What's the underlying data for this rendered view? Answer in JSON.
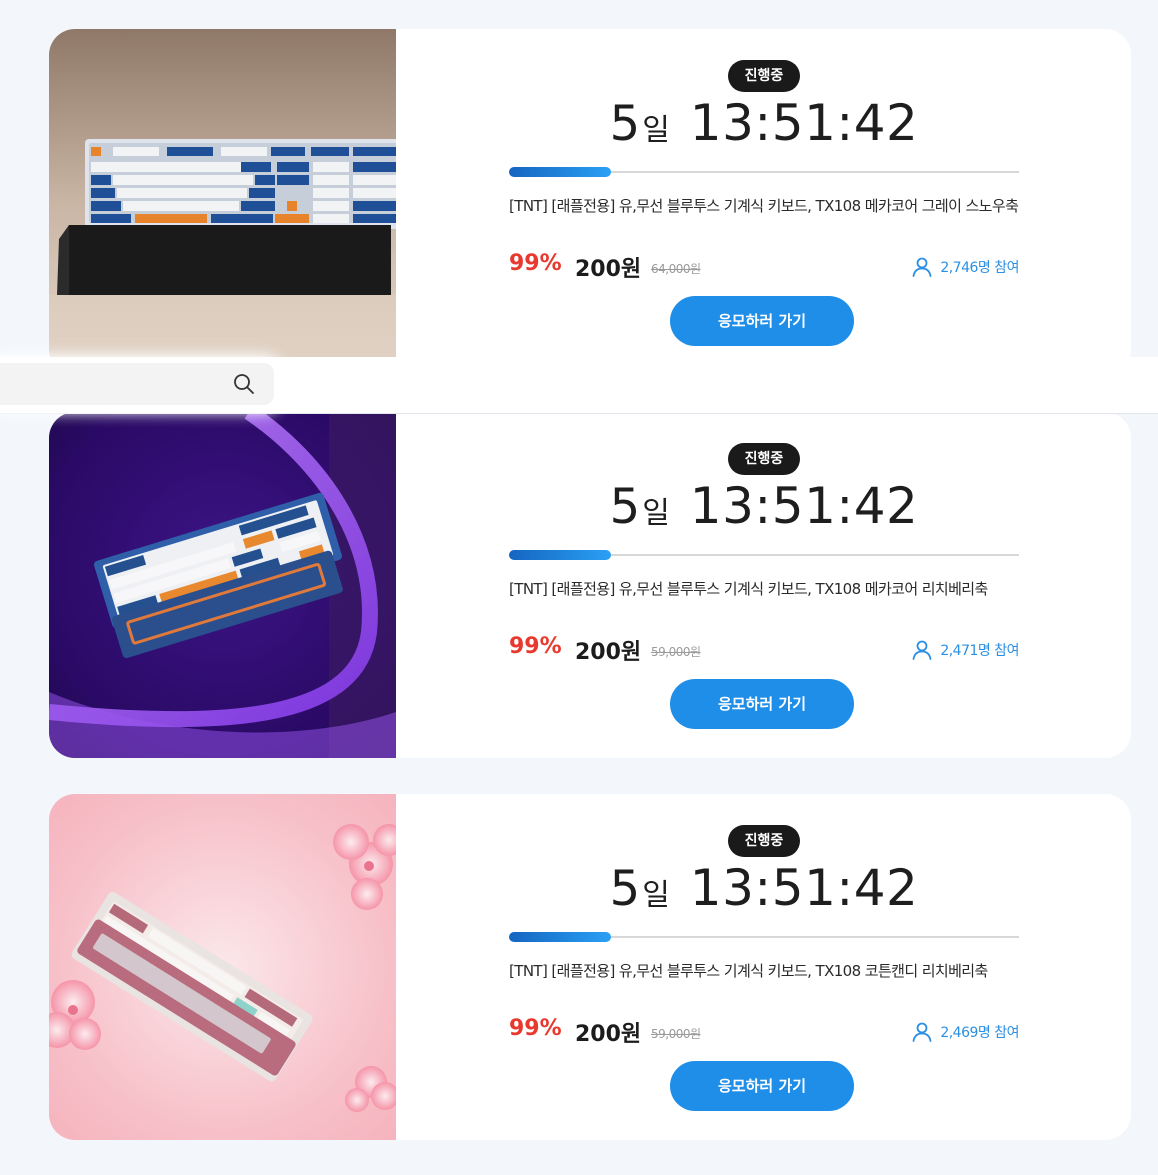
{
  "search": {
    "placeholder": "",
    "icon": "search-icon"
  },
  "colors": {
    "discount": "#e8392f",
    "accent": "#1e8ee8",
    "participants": "#2b8fe3",
    "badge_bg": "#1a1a1a",
    "page_bg": "#f3f7fc"
  },
  "cards": [
    {
      "status": "진행중",
      "countdown": {
        "days": "5",
        "days_unit": "일",
        "time": "13:51:42"
      },
      "progress_fraction": 0.2,
      "name": "[TNT] [래플전용] 유,무선 블루투스 기계식 키보드, TX108 메카코어 그레이 스노우축",
      "discount": "99%",
      "price": "200원",
      "original_price": "64,000원",
      "participants": "2,746명 참여",
      "cta": "응모하러 가기",
      "image_desc_icon": "keyboard-image"
    },
    {
      "status": "진행중",
      "countdown": {
        "days": "5",
        "days_unit": "일",
        "time": "13:51:42"
      },
      "progress_fraction": 0.2,
      "name": "[TNT] [래플전용] 유,무선 블루투스 기계식 키보드, TX108 메카코어 리치베리축",
      "discount": "99%",
      "price": "200원",
      "original_price": "59,000원",
      "participants": "2,471명 참여",
      "cta": "응모하러 가기",
      "image_desc_icon": "keyboard-image"
    },
    {
      "status": "진행중",
      "countdown": {
        "days": "5",
        "days_unit": "일",
        "time": "13:51:42"
      },
      "progress_fraction": 0.2,
      "name": "[TNT] [래플전용] 유,무선 블루투스 기계식 키보드, TX108 코튼캔디 리치베리축",
      "discount": "99%",
      "price": "200원",
      "original_price": "59,000원",
      "participants": "2,469명 참여",
      "cta": "응모하러 가기",
      "image_desc_icon": "keyboard-image"
    }
  ]
}
